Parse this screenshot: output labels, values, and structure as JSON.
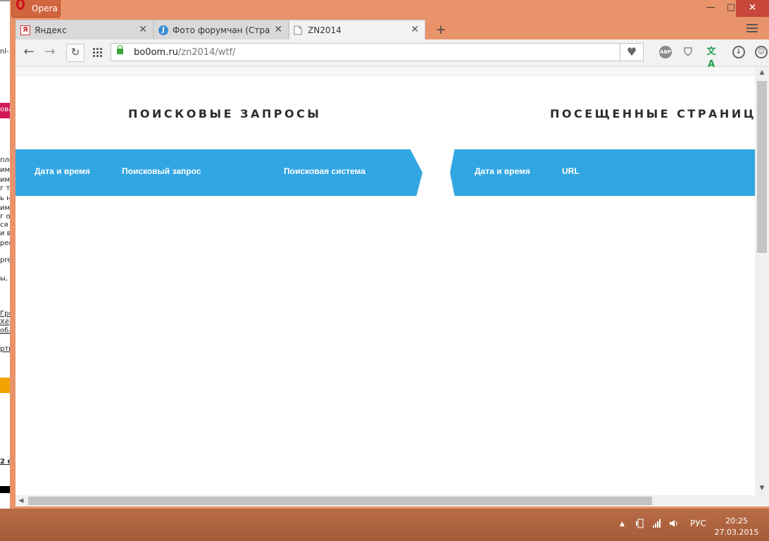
{
  "background_window": {
    "fragments": [
      "nl-",
      "ова",
      "пло",
      "име",
      "име",
      "г то",
      "ь н",
      "име",
      "г от",
      "ся в",
      "и в",
      "рес",
      "pre",
      "ы, с",
      "Гри",
      "Хёр",
      "обл",
      "рти",
      "2 с"
    ]
  },
  "window": {
    "app_name": "Opera",
    "controls": {
      "minimize": "—",
      "maximize": "□",
      "close": "✕"
    }
  },
  "tabs": [
    {
      "title": "Яндекс",
      "favicon": "yandex-icon",
      "active": false
    },
    {
      "title": "Фото форумчан (Страниц",
      "favicon": "j-icon",
      "active": false
    },
    {
      "title": "ZN2014",
      "favicon": "page-icon",
      "active": true
    }
  ],
  "new_tab_label": "+",
  "toolbar": {
    "back": "←",
    "forward": "→",
    "reload": "↻",
    "url_domain": "bo0om.ru",
    "url_path": "/zn2014/wtf/",
    "extensions": [
      "abp-icon",
      "shield-icon",
      "translate-icon",
      "download-icon",
      "account-icon"
    ],
    "abp_label": "ABP"
  },
  "page": {
    "left_title": "ПОИСКОВЫЕ ЗАПРОСЫ",
    "right_title": "ПОСЕЩЕННЫЕ СТРАНИЦЫ",
    "left_columns": [
      "Дата и время",
      "Поисковый запрос",
      "Поисковая система"
    ],
    "right_columns": [
      "Дата и время",
      "URL"
    ],
    "header_color": "#32a6e2"
  },
  "taskbar": {
    "language": "РУС",
    "time": "20:25",
    "date": "27.03.2015"
  },
  "colors": {
    "window_frame": "#e9936a",
    "close_button": "#c7473b",
    "taskbar": "#a65c39"
  }
}
